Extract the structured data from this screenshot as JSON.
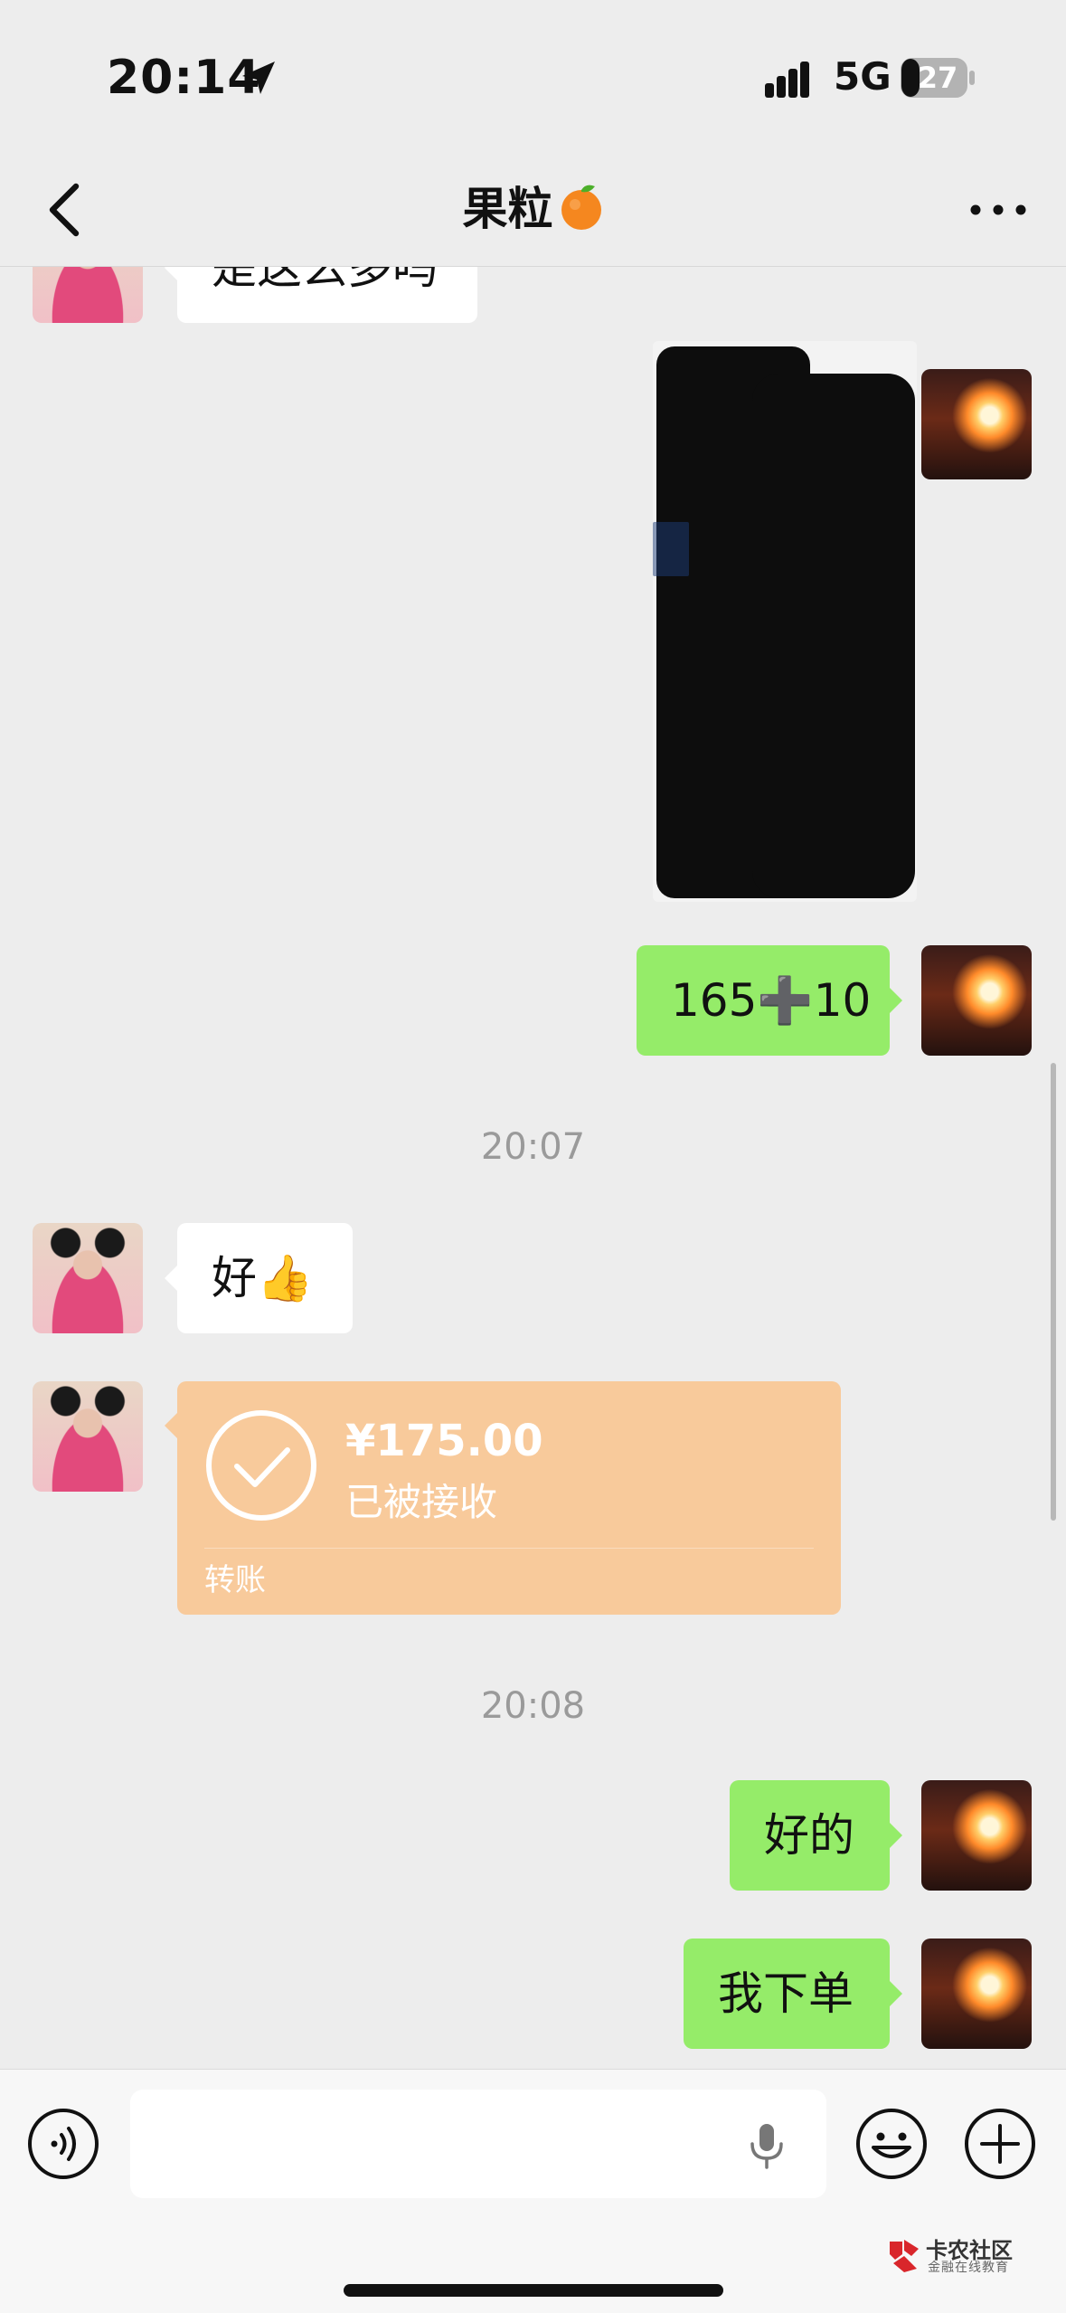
{
  "status_bar": {
    "time": "20:14",
    "network": "5G",
    "battery": "27",
    "icons": [
      "location-arrow-icon",
      "signal-bars-icon",
      "battery-icon"
    ]
  },
  "nav": {
    "title": "果粒",
    "title_emoji_icon": "orange-fruit-icon",
    "back_icon": "chevron-left-icon",
    "more_icon": "more-dots-icon"
  },
  "messages": [
    {
      "side": "left",
      "type": "text",
      "text": "是这么多吗"
    },
    {
      "side": "right",
      "type": "image",
      "note": "screenshot-thumbnail"
    },
    {
      "side": "right",
      "type": "text",
      "text": "165➕10"
    },
    {
      "type": "time",
      "text": "20:07"
    },
    {
      "side": "left",
      "type": "text",
      "text": "好👍"
    },
    {
      "side": "left",
      "type": "transfer",
      "amount": "¥175.00",
      "status": "已被接收",
      "label": "转账"
    },
    {
      "type": "time",
      "text": "20:08"
    },
    {
      "side": "right",
      "type": "text",
      "text": "好的"
    },
    {
      "side": "right",
      "type": "text",
      "text": "我下单"
    }
  ],
  "input_bar": {
    "placeholder": "",
    "icons": [
      "voice-icon",
      "microphone-icon",
      "emoji-icon",
      "plus-icon"
    ]
  },
  "watermark": {
    "title": "卡农社区",
    "subtitle": "金融在线教育"
  },
  "colors": {
    "background": "#ededed",
    "bubble_self": "#95ec69",
    "bubble_other": "#ffffff",
    "transfer_card": "#f8ca9b"
  }
}
